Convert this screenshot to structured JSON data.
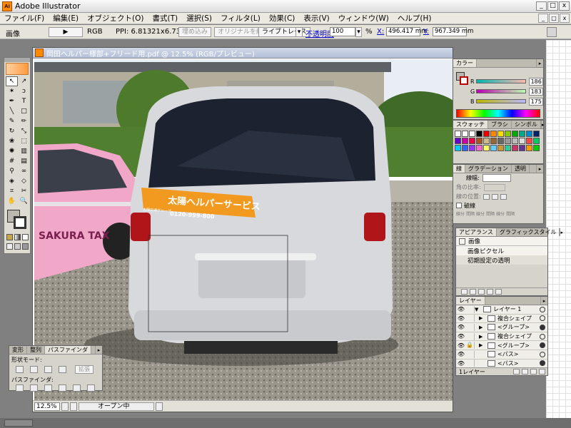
{
  "window": {
    "title": "Adobe Illustrator",
    "min": "_",
    "max": "□",
    "close": "x"
  },
  "menu": [
    "ファイル(F)",
    "編集(E)",
    "オブジェクト(O)",
    "書式(T)",
    "選択(S)",
    "フィルタ(L)",
    "効果(C)",
    "表示(V)",
    "ウィンドウ(W)",
    "ヘルプ(H)"
  ],
  "control": {
    "object_type": "画像",
    "color_mode": "RGB",
    "ppi": "PPI: 6.81321x6.73666",
    "embed_button": "埋め込み",
    "edit_original_button": "オリジナルを編集",
    "live_trace_button": "ライブトレース",
    "opacity_label": "不透明度",
    "opacity_value": "100",
    "percent": "%",
    "x_label": "X:",
    "x_value": "496.417 mm",
    "y_label": "Y:",
    "y_value": "967.349 mm"
  },
  "document": {
    "title": "岡田ヘルパー様部+フリード用.pdf @ 12.5% (RGB/プレビュー)",
    "zoom": "12.5%",
    "status": "オープン中",
    "photo": {
      "sticker_title": "太陽ヘルパーサービス",
      "sticker_phone": "0120-999-800",
      "sticker_group": "太陽交通グループ",
      "taxi_text": "SAKURA TAX"
    }
  },
  "color_panel": {
    "title": "カラー",
    "channels": [
      {
        "label": "R",
        "value": "186"
      },
      {
        "label": "G",
        "value": "183"
      },
      {
        "label": "B",
        "value": "175"
      }
    ]
  },
  "swatch_panel": {
    "tabs": [
      "スウォッチ",
      "ブラシ",
      "シンボル"
    ]
  },
  "stroke_panel": {
    "tabs": [
      "線",
      "グラデーション",
      "透明"
    ],
    "weight_label": "線幅:",
    "cap_label": "角の比率:",
    "corner_label": "線の位置:",
    "dashed_label": "破線",
    "dash_cells": [
      "線分",
      "間隔",
      "線分",
      "間隔",
      "線分",
      "間隔"
    ]
  },
  "appearance_panel": {
    "tabs": [
      "アピアランス",
      "グラフィックスタイル"
    ],
    "rows": [
      "画像",
      "画像ピクセル",
      "初期設定の透明"
    ]
  },
  "layers_panel": {
    "tab": "レイヤー",
    "rows": [
      {
        "name": "レイヤー 1",
        "level": 0
      },
      {
        "name": "複合シェイプ",
        "level": 1
      },
      {
        "name": "<グループ>",
        "level": 1
      },
      {
        "name": "複合シェイプ",
        "level": 1
      },
      {
        "name": "<グループ>",
        "level": 1
      },
      {
        "name": "<パス>",
        "level": 1
      },
      {
        "name": "<パス>",
        "level": 1
      }
    ],
    "footer": "1レイヤー"
  },
  "pathfinder_panel": {
    "tabs": [
      "変形",
      "整列",
      "パスファインダ"
    ],
    "shape_mode_label": "形状モード:",
    "expand_button": "拡張",
    "pathfinder_label": "パスファインダ:"
  },
  "colors": {
    "accent": "#ff8a00",
    "sticker_orange": "#f29a1f",
    "taxi_pink": "#f1a7c8"
  }
}
